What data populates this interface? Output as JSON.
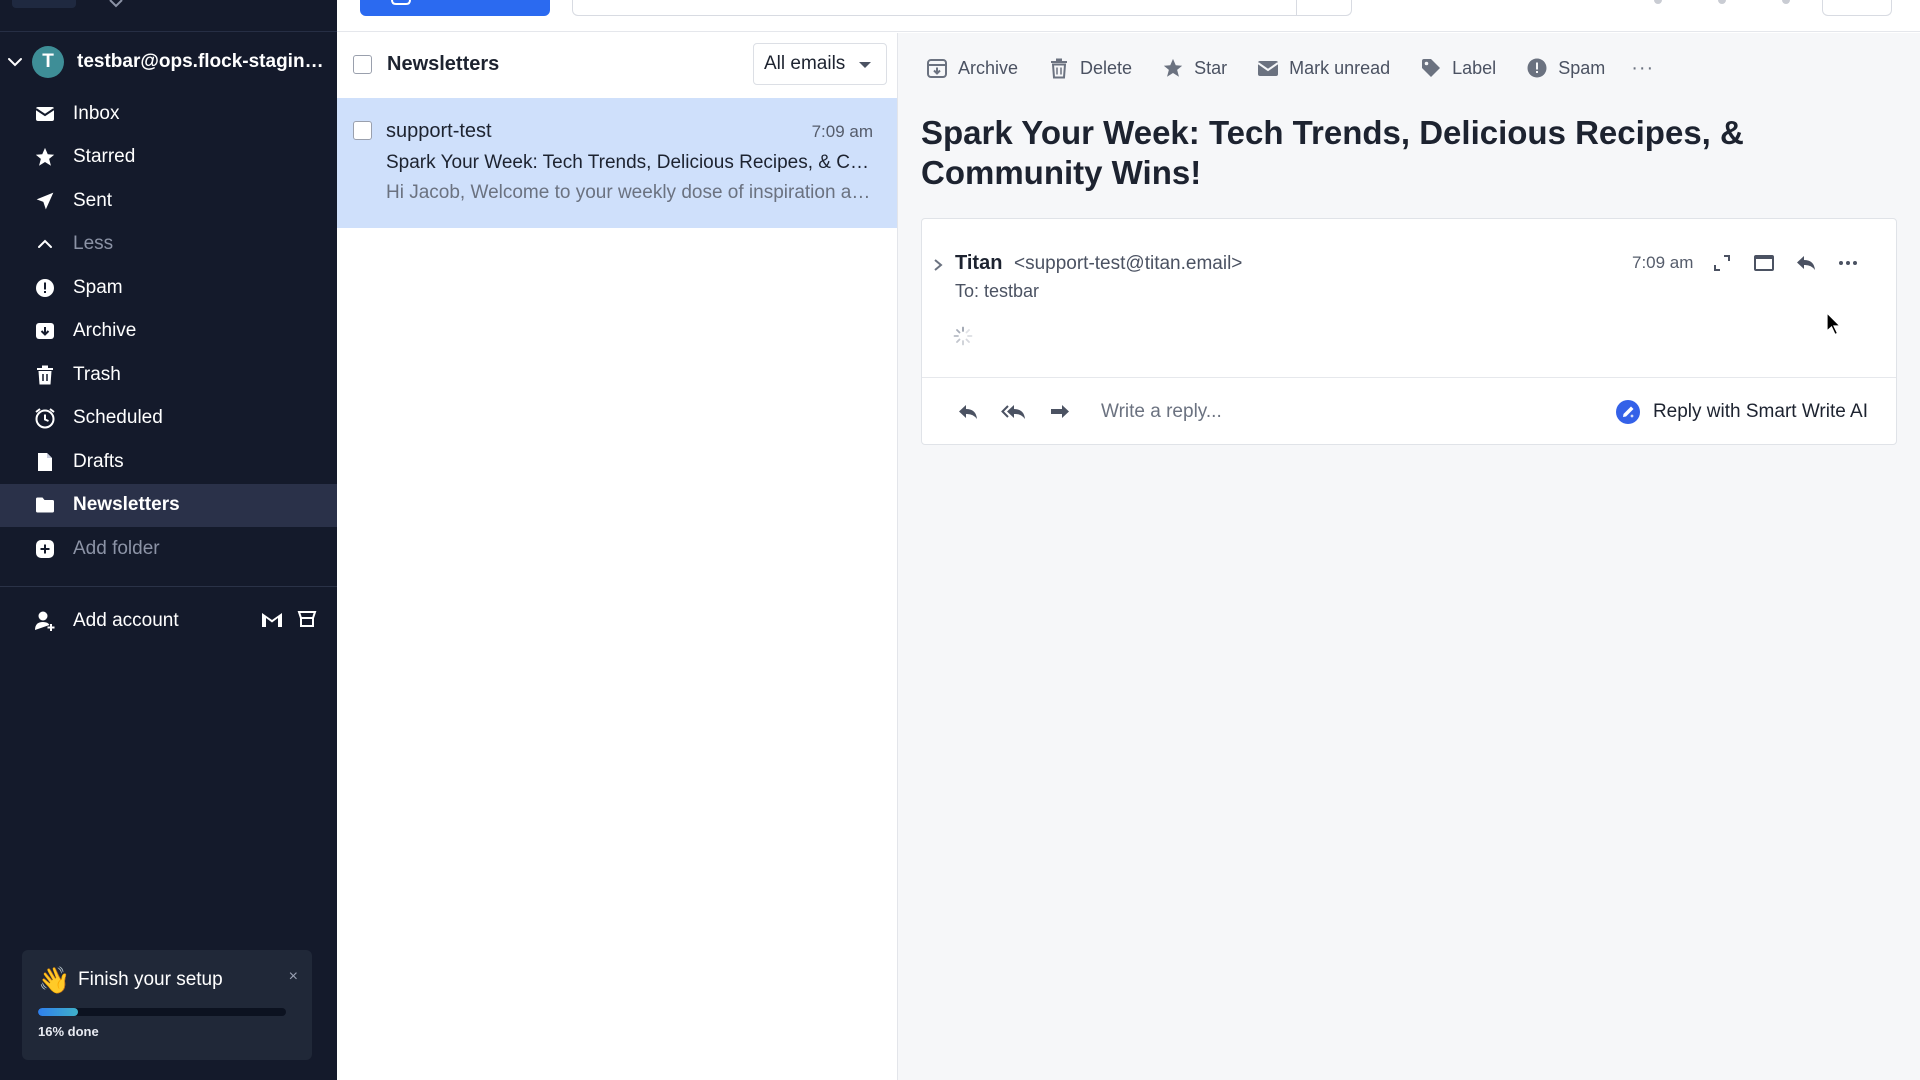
{
  "account": {
    "avatar_letter": "T",
    "email": "testbar@ops.flock-staging.com"
  },
  "sidebar": {
    "items": [
      {
        "label": "Inbox",
        "icon": "inbox-icon"
      },
      {
        "label": "Starred",
        "icon": "star-icon"
      },
      {
        "label": "Sent",
        "icon": "send-icon"
      },
      {
        "label": "Less",
        "icon": "chevron-up-icon"
      },
      {
        "label": "Spam",
        "icon": "alert-circle-icon"
      },
      {
        "label": "Archive",
        "icon": "archive-icon"
      },
      {
        "label": "Trash",
        "icon": "trash-icon"
      },
      {
        "label": "Scheduled",
        "icon": "clock-icon"
      },
      {
        "label": "Drafts",
        "icon": "drafts-icon"
      },
      {
        "label": "Newsletters",
        "icon": "folder-icon",
        "active": true
      },
      {
        "label": "Add folder",
        "icon": "plus-circle-icon"
      }
    ],
    "add_account_label": "Add account",
    "setup": {
      "title": "Finish your setup",
      "wave_emoji": "👋",
      "close": "×",
      "progress_percent": 16,
      "progress_text": "16% done"
    }
  },
  "list": {
    "folder_title": "Newsletters",
    "filter_selected": "All emails",
    "messages": [
      {
        "sender": "support-test",
        "time": "7:09 am",
        "subject": "Spark Your Week: Tech Trends, Delicious Recipes, & Community Wins!",
        "preview": "Hi Jacob, Welcome to your weekly dose of inspiration and updates"
      }
    ]
  },
  "toolbar": {
    "archive": "Archive",
    "delete": "Delete",
    "star": "Star",
    "mark_unread": "Mark unread",
    "label": "Label",
    "spam": "Spam",
    "more": "···"
  },
  "email": {
    "subject": "Spark Your Week: Tech Trends, Delicious Recipes, & Community Wins!",
    "sender_name": "Titan",
    "sender_email": "<support-test@titan.email>",
    "to": "To: testbar",
    "time": "7:09 am",
    "more": "···",
    "reply_placeholder": "Write a reply...",
    "smart_write_label": "Reply with Smart Write AI"
  },
  "colors": {
    "sidebar_bg": "#141a2b",
    "accent": "#2b6af0",
    "selected_row": "#cfe0fb"
  }
}
